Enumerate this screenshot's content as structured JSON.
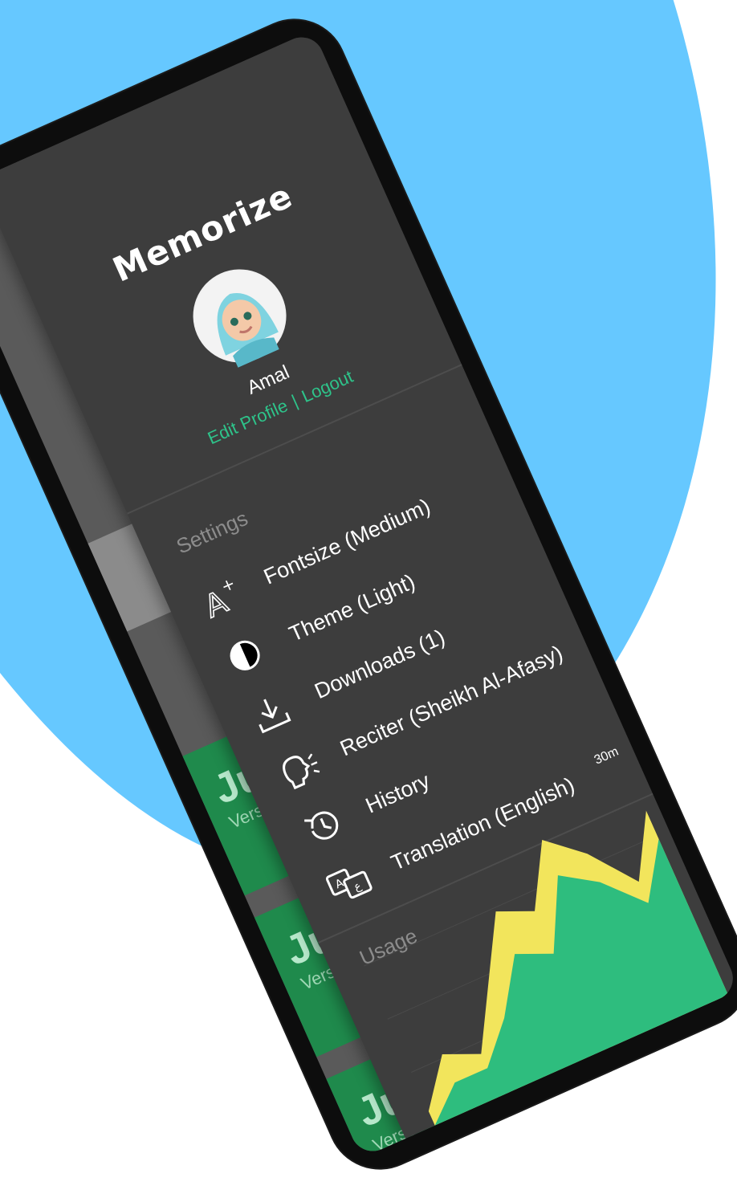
{
  "drawer": {
    "app_title": "Memorize",
    "user": {
      "name": "Amal",
      "edit_profile": "Edit Profile",
      "separator": "|",
      "logout": "Logout"
    },
    "settings_label": "Settings",
    "menu": [
      {
        "label": "Fontsize (Medium)",
        "icon": "font-size-icon"
      },
      {
        "label": "Theme (Light)",
        "icon": "theme-contrast-icon"
      },
      {
        "label": "Downloads (1)",
        "icon": "download-icon"
      },
      {
        "label": "Reciter (Sheikh Al-Afasy)",
        "icon": "reciter-voice-icon"
      },
      {
        "label": "History",
        "icon": "history-icon"
      },
      {
        "label": "Translation (English)",
        "icon": "translate-icon"
      }
    ],
    "usage_label": "Usage",
    "accent_color": "#2ec38a"
  },
  "chart_data": {
    "type": "area",
    "title": "Usage",
    "tick_labels": [
      "30m"
    ],
    "series": [
      {
        "color": "#f2e55c",
        "values": [
          2,
          8,
          6,
          14,
          22,
          20,
          28,
          24,
          18,
          26
        ]
      },
      {
        "color": "#2ebd7e",
        "values": [
          0,
          4,
          4,
          9,
          16,
          14,
          23,
          20,
          15,
          22
        ]
      }
    ]
  },
  "background": {
    "juz_cards": [
      {
        "title": "Juz",
        "sub": "Verse"
      },
      {
        "title": "Juz",
        "sub": "Verse"
      },
      {
        "title": "Juz",
        "sub": "Verse"
      }
    ]
  }
}
